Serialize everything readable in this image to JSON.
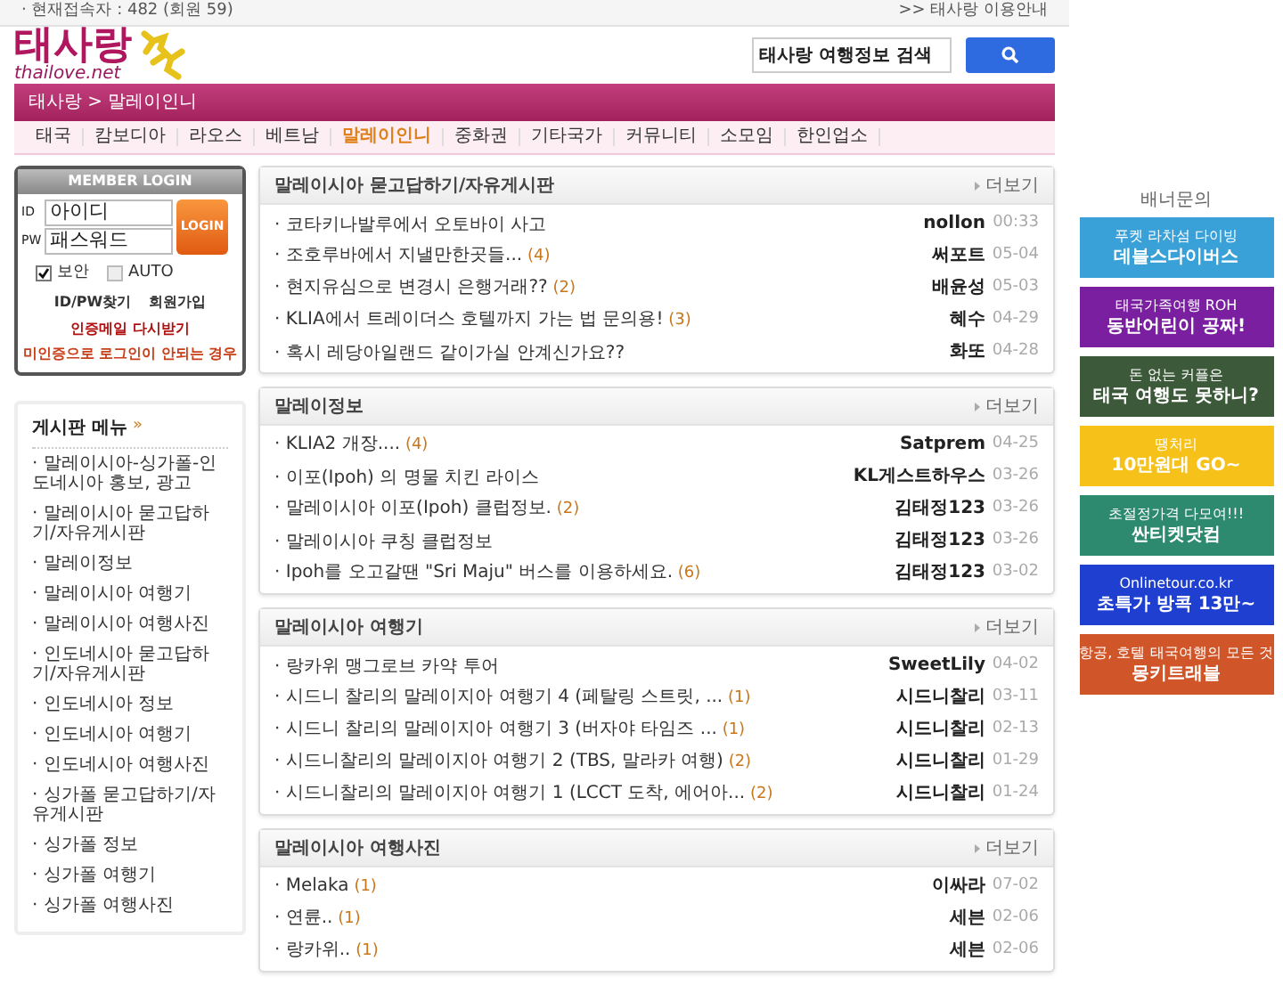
{
  "bullet": "·",
  "top_bar": {
    "visitors": "· 현재접속자 : 482 (회원 59)",
    "guide_link": ">> 태사랑 이용안내"
  },
  "logo": {
    "name": "태사랑",
    "domain": "thailove.net"
  },
  "search": {
    "value": "태사랑 여행정보 검색"
  },
  "breadcrumb": "태사랑 > 말레이인니",
  "nav": [
    {
      "label": "태국",
      "selected": false
    },
    {
      "label": "캄보디아",
      "selected": false
    },
    {
      "label": "라오스",
      "selected": false
    },
    {
      "label": "베트남",
      "selected": false
    },
    {
      "label": "말레이인니",
      "selected": true
    },
    {
      "label": "중화권",
      "selected": false
    },
    {
      "label": "기타국가",
      "selected": false
    },
    {
      "label": "커뮤니티",
      "selected": false
    },
    {
      "label": "소모임",
      "selected": false
    },
    {
      "label": "한인업소",
      "selected": false
    }
  ],
  "login": {
    "title": "MEMBER LOGIN",
    "id_label": "ID",
    "pw_label": "PW",
    "id_placeholder": "아이디",
    "pw_placeholder": "패스워드",
    "button": "LOGIN",
    "options": [
      {
        "label": "보안",
        "checked": true
      },
      {
        "label": "AUTO",
        "checked": false
      }
    ],
    "links": [
      "ID/PW찾기",
      "회원가입"
    ],
    "resend": "인증메일 다시받기",
    "trouble": "미인증으로 로그인이 안되는 경우"
  },
  "board_menu": {
    "title": "게시판 메뉴",
    "more": "»",
    "items": [
      "말레이시아-싱가폴-인도네시아 홍보, 광고",
      "말레이시아 묻고답하기/자유게시판",
      "말레이정보",
      "말레이시아 여행기",
      "말레이시아 여행사진",
      "인도네시아 묻고답하기/자유게시판",
      "인도네시아 정보",
      "인도네시아 여행기",
      "인도네시아 여행사진",
      "싱가폴 묻고답하기/자유게시판",
      "싱가폴 정보",
      "싱가폴 여행기",
      "싱가폴 여행사진"
    ]
  },
  "sections": [
    {
      "title": "말레이시아 묻고답하기/자유게시판",
      "more": "더보기",
      "rows": [
        {
          "title": "코타키나발루에서 오토바이 사고",
          "author": "nollon",
          "date": "00:33"
        },
        {
          "title": "조호루바에서 지낼만한곳들...",
          "count": "(4)",
          "author": "써포트",
          "date": "05-04"
        },
        {
          "title": "현지유심으로 변경시 은행거래??",
          "count": "(2)",
          "author": "배윤성",
          "date": "05-03"
        },
        {
          "title": "KLIA에서 트레이더스 호텔까지 가는 법 문의용!",
          "count": "(3)",
          "author": "혜수",
          "date": "04-29"
        },
        {
          "title": "혹시 레당아일랜드 같이가실 안계신가요??",
          "author": "화또",
          "date": "04-28"
        }
      ]
    },
    {
      "title": "말레이정보",
      "more": "더보기",
      "rows": [
        {
          "title": "KLIA2 개장....",
          "count": "(4)",
          "author": "Satprem",
          "date": "04-25"
        },
        {
          "title": "이포(Ipoh) 의 명물 치킨 라이스",
          "author": "KL게스트하우스",
          "date": "03-26"
        },
        {
          "title": "말레이시아 이포(Ipoh) 클럽정보.",
          "count": "(2)",
          "author": "김태정123",
          "date": "03-26"
        },
        {
          "title": "말레이시아 쿠칭 클럽정보",
          "author": "김태정123",
          "date": "03-26"
        },
        {
          "title": "Ipoh를 오고갈땐 \"Sri Maju\" 버스를 이용하세요.",
          "count": "(6)",
          "author": "김태정123",
          "date": "03-02"
        }
      ]
    },
    {
      "title": "말레이시아 여행기",
      "more": "더보기",
      "rows": [
        {
          "title": "랑카위 맹그로브 카약 투어",
          "author": "SweetLily",
          "date": "04-02"
        },
        {
          "title": "시드니 찰리의 말레이지아 여행기 4 (페탈링 스트릿, ...",
          "count": "(1)",
          "author": "시드니찰리",
          "date": "03-11"
        },
        {
          "title": "시드니 찰리의 말레이지아 여행기 3 (버자야 타임즈 ...",
          "count": "(1)",
          "author": "시드니찰리",
          "date": "02-13"
        },
        {
          "title": "시드니찰리의 말레이지아 여행기 2 (TBS, 말라카 여행)",
          "count": "(2)",
          "author": "시드니찰리",
          "date": "01-29"
        },
        {
          "title": "시드니찰리의 말레이지아 여행기 1 (LCCT 도착, 에어아...",
          "count": "(2)",
          "author": "시드니찰리",
          "date": "01-24"
        }
      ]
    },
    {
      "title": "말레이시아 여행사진",
      "more": "더보기",
      "rows": [
        {
          "title": "Melaka",
          "count": "(1)",
          "author": "이싸라",
          "date": "07-02"
        },
        {
          "title": "연륜..",
          "count": "(1)",
          "author": "세븐",
          "date": "02-06"
        },
        {
          "title": "랑카위..",
          "count": "(1)",
          "author": "세븐",
          "date": "02-06"
        }
      ]
    }
  ],
  "banners": {
    "label": "배너문의",
    "items": [
      {
        "lines": [
          "푸켓 라차섬 다이빙",
          "데블스다이버스"
        ],
        "color": "#3aa0d8"
      },
      {
        "lines": [
          "태국가족여행 ROH",
          "동반어린이 공짜!"
        ],
        "color": "#7a1fa0"
      },
      {
        "lines": [
          "돈 없는 커플은",
          "태국 여행도 못하니?"
        ],
        "color": "#3c5a3a"
      },
      {
        "lines": [
          "땡처리",
          "10만원대 GO~"
        ],
        "color": "#f6c21a"
      },
      {
        "lines": [
          "초절정가격 다모여!!!",
          "싼티켓닷컴"
        ],
        "color": "#2e8a6e"
      },
      {
        "lines": [
          "Onlinetour.co.kr",
          "초특가 방콕 13만~"
        ],
        "color": "#1e3fd0"
      },
      {
        "lines": [
          "항공, 호텔 태국여행의 모든 것",
          "몽키트래블"
        ],
        "color": "#d0562a"
      }
    ]
  }
}
